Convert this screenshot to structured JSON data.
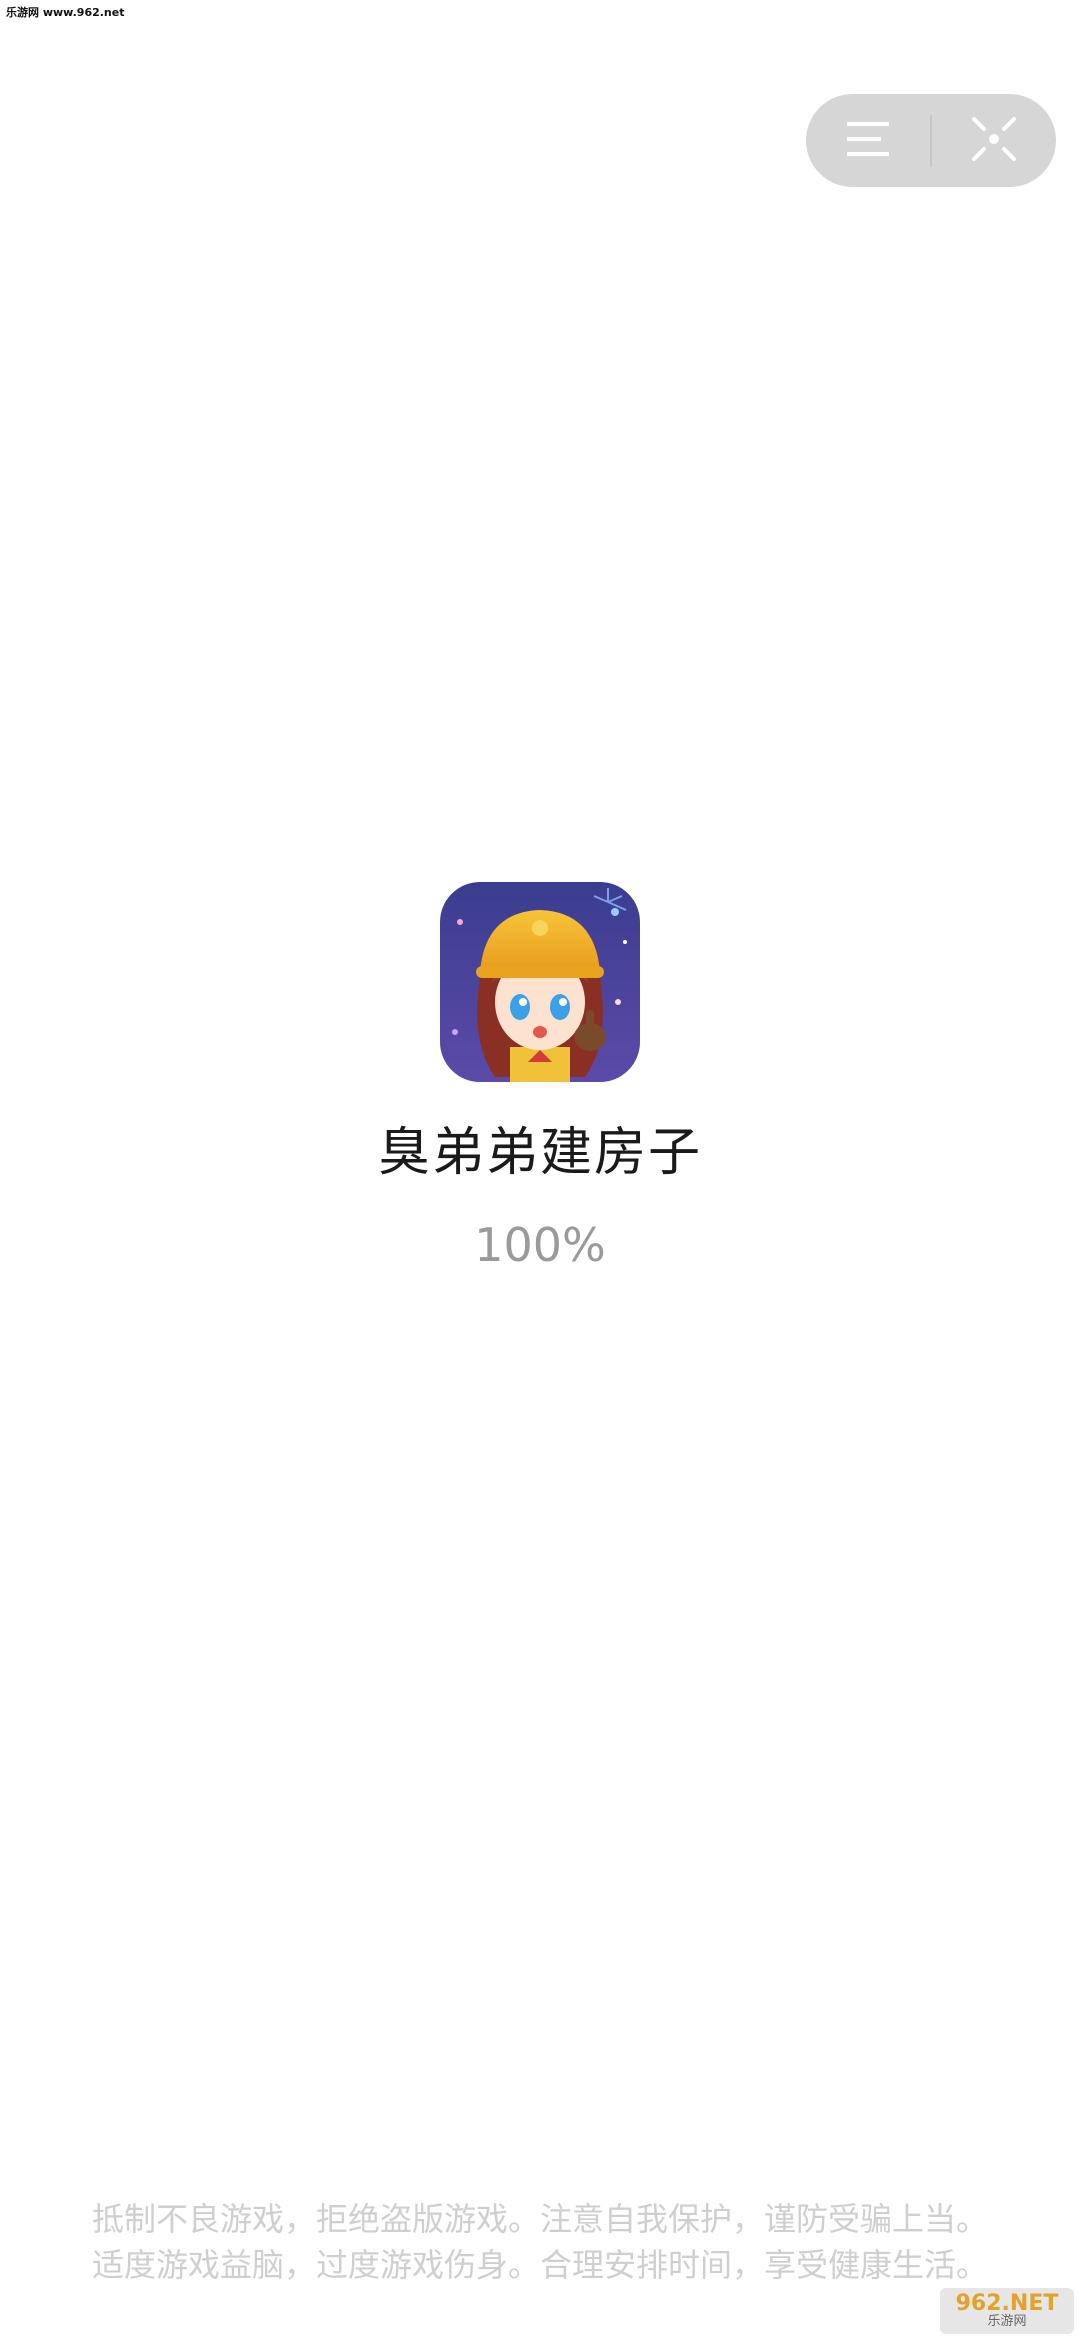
{
  "watermark": {
    "top_left": "乐游网 www.962.net",
    "corner_top": "962.NET",
    "corner_bottom": "乐游网"
  },
  "capsule": {
    "menu_icon": "menu-lines-icon",
    "close_icon": "target-close-icon"
  },
  "game": {
    "title": "臭弟弟建房子",
    "progress": "100%",
    "progress_value": 1.0
  },
  "notice": {
    "line1": "抵制不良游戏，拒绝盗版游戏。注意自我保护，谨防受骗上当。",
    "line2": "适度游戏益脑，过度游戏伤身。合理安排时间，享受健康生活。"
  },
  "colors": {
    "capsule_bg": "#d6d6d6",
    "title": "#1a1a1a",
    "progress": "#9a9a9a",
    "notice": "#cfcfcf"
  }
}
